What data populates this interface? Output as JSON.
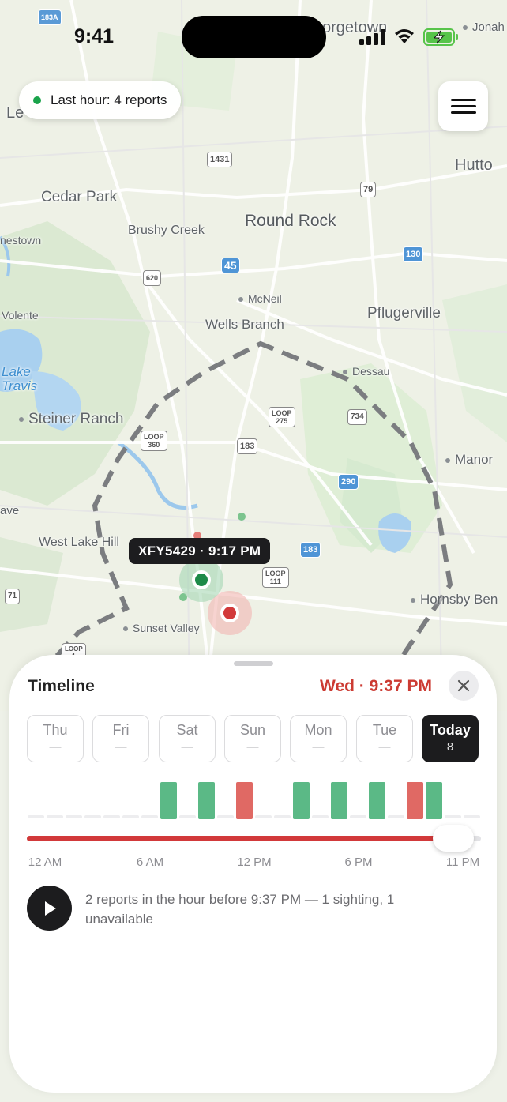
{
  "status_bar": {
    "time": "9:41"
  },
  "map": {
    "labels": {
      "georgetown": "orgetown",
      "jonah": "Jonah",
      "leander": "Le",
      "hutto": "Hutto",
      "cedar_park": "Cedar Park",
      "round_rock": "Round Rock",
      "brushy_creek": "Brushy Creek",
      "jonestown": "nestown",
      "mcneil": "McNeil",
      "pflugerville": "Pflugerville",
      "volente": "Volente",
      "wells_branch": "Wells Branch",
      "lake_travis": "Lake\nTravis",
      "dessau": "Dessau",
      "steiner_ranch": "Steiner Ranch",
      "manor": "Manor",
      "cave": "ave",
      "west_lake_hills": "West Lake Hill",
      "hornsby_bend": "Hornsby Ben",
      "sunset_valley": "Sunset Valley"
    },
    "shields": {
      "s183a": "183A",
      "s1431": "1431",
      "s79": "79",
      "s45": "45",
      "s130": "130",
      "s620": "620",
      "sloop275": "LOOP\n275",
      "s734": "734",
      "sloop360": "LOOP\n360",
      "s183": "183",
      "s290": "290",
      "s183t": "183",
      "sloop111": "LOOP\n111",
      "s71": "71",
      "sloop1": "LOOP\n1"
    },
    "tooltip": "XFY5429 · 9:17 PM"
  },
  "report_pill": {
    "label": "Last hour: 4 reports",
    "dot_color": "#1aa34a"
  },
  "timeline": {
    "title": "Timeline",
    "current_time": "Wed · 9:37 PM",
    "days": [
      {
        "name": "Thu",
        "count": "—"
      },
      {
        "name": "Fri",
        "count": "—"
      },
      {
        "name": "Sat",
        "count": "—"
      },
      {
        "name": "Sun",
        "count": "—"
      },
      {
        "name": "Mon",
        "count": "—"
      },
      {
        "name": "Tue",
        "count": "—"
      },
      {
        "name": "Today",
        "count": "8",
        "selected": true
      }
    ],
    "hour_reports": [
      {
        "hour": 7,
        "status": "sighting"
      },
      {
        "hour": 9,
        "status": "sighting"
      },
      {
        "hour": 11,
        "status": "unavailable"
      },
      {
        "hour": 14,
        "status": "sighting"
      },
      {
        "hour": 16,
        "status": "sighting"
      },
      {
        "hour": 18,
        "status": "sighting"
      },
      {
        "hour": 20,
        "status": "unavailable"
      },
      {
        "hour": 21,
        "status": "sighting"
      }
    ],
    "colors": {
      "sighting": "#5bb986",
      "unavailable": "#e06964",
      "empty": "#ededef"
    },
    "slider_value_hours": 21.6,
    "slider_range_hours": [
      0,
      23
    ],
    "ticks": [
      "12 AM",
      "6 AM",
      "12 PM",
      "6 PM",
      "11 PM"
    ],
    "summary": "2 reports in the hour before 9:37 PM — 1 sighting, 1 unavailable"
  }
}
